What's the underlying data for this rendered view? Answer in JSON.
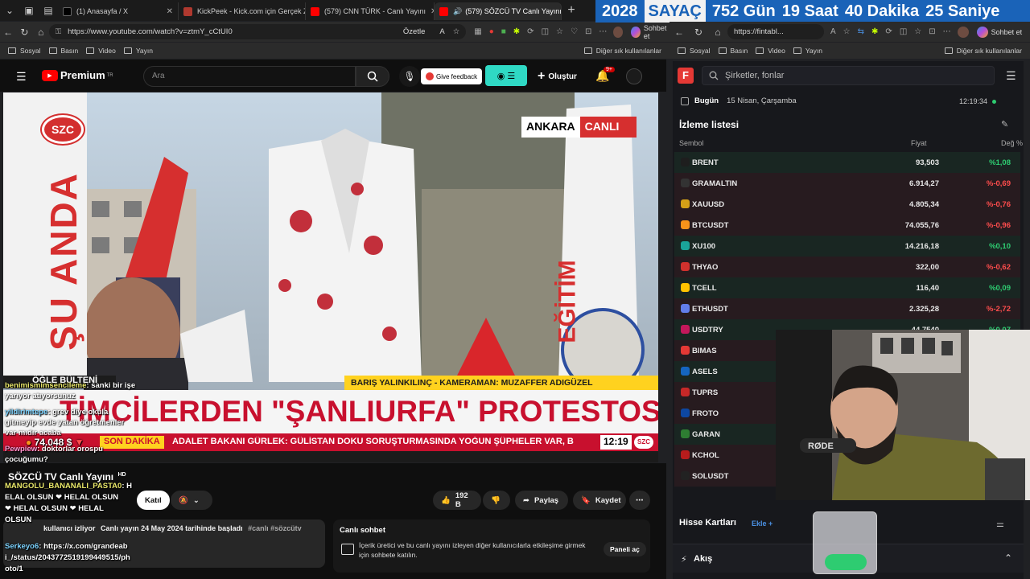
{
  "counter": {
    "year": "2028",
    "label": "SAYAÇ",
    "days": "752 Gün",
    "hours": "19 Saat",
    "minutes": "40 Dakika",
    "seconds": "25 Saniye"
  },
  "tabs": [
    {
      "label": "(1) Anasayfa / X",
      "color": "#000000"
    },
    {
      "label": "KickPeek - Kick.com için Gerçek Za",
      "color": "#b0392f"
    },
    {
      "label": "(579) CNN TÜRK - Canlı Yayını",
      "color": "#ff0000"
    },
    {
      "label": "(579) SÖZCÜ TV Canlı Yayını",
      "color": "#ff0000"
    }
  ],
  "left_browser": {
    "url": "https://www.youtube.com/watch?v=ztmY_cCtUI0",
    "summarize": "Özetle",
    "chat_label": "Sohbet et",
    "bookmarks": [
      "Sosyal",
      "Basın",
      "Video",
      "Yayın"
    ],
    "other_bookmarks": "Diğer sık kullanılanlar"
  },
  "youtube": {
    "logo": "Premium",
    "logo_sup": "TR",
    "search_placeholder": "Ara",
    "give_feedback": "Give feedback",
    "create": "Oluştur",
    "notif_count": "9+",
    "channel": "SÖZCÜ TV Canlı Yayını",
    "channel_badge": "HD",
    "join": "Katıl",
    "likes": "192 B",
    "share": "Paylaş",
    "save": "Kaydet",
    "viewers": "kullanıcı izliyor",
    "started": "Canlı yayın 24 May 2024 tarihinde başladı",
    "hashtags": "#canlı #sözcütv",
    "live_chat_title": "Canlı sohbet",
    "live_chat_text": "İçerik üretici ve bu canlı yayını izleyen diğer kullanıcılarla etkileşime girmek için sohbete katılın.",
    "open_panel": "Paneli aç"
  },
  "video": {
    "channel_logo": "SZC",
    "side_text": "ŞU ANDA",
    "city": "ANKARA",
    "live": "CANLI",
    "show": "ÖĞLE BÜLTENİ",
    "credits": "BARIŞ YALINKILINÇ - KAMERAMAN: MUZAFFER ADIGÜZEL",
    "headline": "TİMCİLERDEN \"ŞANLIURFA\" PROTESTOSU",
    "breaking": "SON DAKİKA",
    "ticker": "ADALET BAKANI GÜRLEK: GÜLİSTAN DOKU SORUŞTURMASINDA YOĞUN ŞÜPHELER VAR, B",
    "time": "12:19",
    "corner_logo": "SZC",
    "banner_text": "EĞİTİM"
  },
  "chat_overlay": [
    {
      "user": "benimismimsencileme",
      "text": ": sanki bir işe"
    },
    {
      "user": "",
      "text": "yarıyor atıyorsunuz"
    },
    {
      "user": "yildirimtepe",
      "text": ": grev diye okula"
    },
    {
      "user": "",
      "text": "gitmeyip evde yatan öğretmenler"
    },
    {
      "user": "",
      "text": "var mıdır acaba"
    },
    {
      "user": "Pewpiew",
      "text": ": doktorlar orospu"
    },
    {
      "user": "",
      "text": "çocuğumu?"
    },
    {
      "user": "MANGOLU_BANANALI_PASTA0",
      "text": ": H"
    },
    {
      "user": "",
      "text": "ELAL OLSUN ❤ HELAL OLSUN"
    },
    {
      "user": "",
      "text": "❤ HELAL OLSUN ❤ HELAL"
    },
    {
      "user": "",
      "text": "OLSUN"
    },
    {
      "user": "Serkeyo6",
      "text": ": https://x.com/grandeab"
    },
    {
      "user": "",
      "text": "i_/status/2043772519199449515/ph"
    },
    {
      "user": "",
      "text": "oto/1"
    }
  ],
  "overlay_price": "74.048 $",
  "right_browser": {
    "url": "https://fintabl...",
    "chat_label": "Sohbet et",
    "bookmarks": [
      "Sosyal",
      "Basın",
      "Video",
      "Yayın"
    ],
    "other_bookmarks": "Diğer sık kullanılanlar"
  },
  "finance": {
    "logo": "F",
    "search_placeholder": "Şirketler, fonlar",
    "today": "Bugün",
    "date": "15 Nisan, Çarşamba",
    "clock": "12:19:34",
    "watchlist_title": "İzleme listesi",
    "col_symbol": "Sembol",
    "col_price": "Fiyat",
    "col_change": "Değ %",
    "rows": [
      {
        "sym": "BRENT",
        "price": "93,503",
        "chg": "%1,08",
        "dir": "pos",
        "icon": "#1e1e1e"
      },
      {
        "sym": "GRAMALTIN",
        "price": "6.914,27",
        "chg": "%-0,69",
        "dir": "neg",
        "icon": "#333333"
      },
      {
        "sym": "XAUUSD",
        "price": "4.805,34",
        "chg": "%-0,76",
        "dir": "neg",
        "icon": "#d4a017"
      },
      {
        "sym": "BTCUSDT",
        "price": "74.055,76",
        "chg": "%-0,96",
        "dir": "neg",
        "icon": "#f7931a"
      },
      {
        "sym": "XU100",
        "price": "14.216,18",
        "chg": "%0,10",
        "dir": "pos",
        "icon": "#1aa39a"
      },
      {
        "sym": "THYAO",
        "price": "322,00",
        "chg": "%-0,62",
        "dir": "neg",
        "icon": "#d0312d"
      },
      {
        "sym": "TCELL",
        "price": "116,40",
        "chg": "%0,09",
        "dir": "pos",
        "icon": "#ffc300"
      },
      {
        "sym": "ETHUSDT",
        "price": "2.325,28",
        "chg": "%-2,72",
        "dir": "neg",
        "icon": "#627eea"
      },
      {
        "sym": "USDTRY",
        "price": "44,7540",
        "chg": "%0,07",
        "dir": "pos",
        "icon": "#c2185b"
      },
      {
        "sym": "BIMAS",
        "price": "",
        "chg": "",
        "dir": "neg",
        "icon": "#e53935"
      },
      {
        "sym": "ASELS",
        "price": "",
        "chg": "",
        "dir": "pos",
        "icon": "#1565c0"
      },
      {
        "sym": "TUPRS",
        "price": "",
        "chg": "",
        "dir": "neg",
        "icon": "#c62828"
      },
      {
        "sym": "FROTO",
        "price": "",
        "chg": "",
        "dir": "neg",
        "icon": "#0d47a1"
      },
      {
        "sym": "GARAN",
        "price": "",
        "chg": "",
        "dir": "pos",
        "icon": "#2e7d32"
      },
      {
        "sym": "KCHOL",
        "price": "",
        "chg": "",
        "dir": "neg",
        "icon": "#b71c1c"
      },
      {
        "sym": "SOLUSDT",
        "price": "",
        "chg": "",
        "dir": "neg",
        "icon": "#222222"
      }
    ],
    "cards_title": "Hisse Kartları",
    "cards_add": "Ekle",
    "flow": "Akış"
  }
}
